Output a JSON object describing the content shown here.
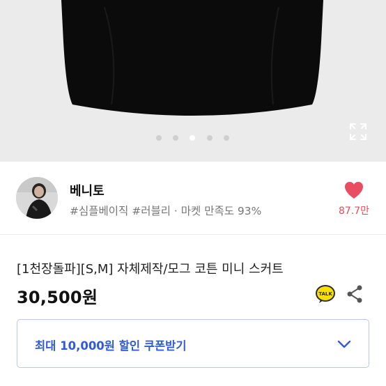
{
  "gallery": {
    "dot_count": 5,
    "active_dot_index": 2
  },
  "seller": {
    "name": "베니토",
    "tags": "#심플베이직 #러블리 · 마켓 만족도 93%",
    "likes": "87.7만"
  },
  "product": {
    "title": "[1천장돌파][S,M] 자체제작/모그 코튼 미니 스커트",
    "price": "30,500원",
    "talk_label": "TALK"
  },
  "coupon": {
    "label": "최대 10,000원 할인 쿠폰받기"
  },
  "colors": {
    "gallery_bg": "#ebebeb",
    "heart": "#ea4d5f",
    "coupon_text": "#2f5cd6",
    "coupon_border": "#b9c8ef",
    "kakao_yellow": "#f9e000"
  },
  "icons": [
    "expand-icon",
    "heart-icon",
    "kakaotalk-icon",
    "share-icon",
    "chevron-down-icon"
  ]
}
